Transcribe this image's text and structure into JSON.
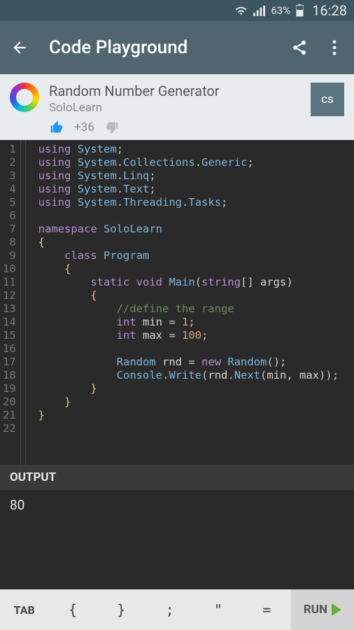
{
  "status": {
    "battery_pct": "63%",
    "time": "16:28"
  },
  "appbar": {
    "title": "Code Playground"
  },
  "project": {
    "name": "Random Number Generator",
    "author": "SoloLearn",
    "votes": "+36",
    "language_badge": "cs"
  },
  "code": {
    "lines": [
      [
        [
          "kw",
          "using"
        ],
        [
          "sp",
          " "
        ],
        [
          "type",
          "System"
        ],
        [
          "punc",
          ";"
        ]
      ],
      [
        [
          "kw",
          "using"
        ],
        [
          "sp",
          " "
        ],
        [
          "type",
          "System"
        ],
        [
          "punc",
          "."
        ],
        [
          "type",
          "Collections"
        ],
        [
          "punc",
          "."
        ],
        [
          "type",
          "Generic"
        ],
        [
          "punc",
          ";"
        ]
      ],
      [
        [
          "kw",
          "using"
        ],
        [
          "sp",
          " "
        ],
        [
          "type",
          "System"
        ],
        [
          "punc",
          "."
        ],
        [
          "type",
          "Linq"
        ],
        [
          "punc",
          ";"
        ]
      ],
      [
        [
          "kw",
          "using"
        ],
        [
          "sp",
          " "
        ],
        [
          "type",
          "System"
        ],
        [
          "punc",
          "."
        ],
        [
          "type",
          "Text"
        ],
        [
          "punc",
          ";"
        ]
      ],
      [
        [
          "kw",
          "using"
        ],
        [
          "sp",
          " "
        ],
        [
          "type",
          "System"
        ],
        [
          "punc",
          "."
        ],
        [
          "type",
          "Threading"
        ],
        [
          "punc",
          "."
        ],
        [
          "type",
          "Tasks"
        ],
        [
          "punc",
          ";"
        ]
      ],
      [],
      [
        [
          "kw",
          "namespace"
        ],
        [
          "sp",
          " "
        ],
        [
          "type",
          "SoloLearn"
        ]
      ],
      [
        [
          "brace",
          "{"
        ]
      ],
      [
        [
          "sp",
          "    "
        ],
        [
          "kw",
          "class"
        ],
        [
          "sp",
          " "
        ],
        [
          "type",
          "Program"
        ]
      ],
      [
        [
          "sp",
          "    "
        ],
        [
          "brace",
          "{"
        ]
      ],
      [
        [
          "sp",
          "        "
        ],
        [
          "kw",
          "static"
        ],
        [
          "sp",
          " "
        ],
        [
          "kw",
          "void"
        ],
        [
          "sp",
          " "
        ],
        [
          "method",
          "Main"
        ],
        [
          "punc",
          "("
        ],
        [
          "kw",
          "string"
        ],
        [
          "punc",
          "[] "
        ],
        [
          "id",
          "args"
        ],
        [
          "punc",
          ")"
        ]
      ],
      [
        [
          "sp",
          "        "
        ],
        [
          "brace",
          "{"
        ]
      ],
      [
        [
          "sp",
          "            "
        ],
        [
          "comment",
          "//define the range"
        ]
      ],
      [
        [
          "sp",
          "            "
        ],
        [
          "kw",
          "int"
        ],
        [
          "sp",
          " "
        ],
        [
          "id",
          "min"
        ],
        [
          "sp",
          " "
        ],
        [
          "punc",
          "="
        ],
        [
          "sp",
          " "
        ],
        [
          "num",
          "1"
        ],
        [
          "punc",
          ";"
        ]
      ],
      [
        [
          "sp",
          "            "
        ],
        [
          "kw",
          "int"
        ],
        [
          "sp",
          " "
        ],
        [
          "id",
          "max"
        ],
        [
          "sp",
          " "
        ],
        [
          "punc",
          "="
        ],
        [
          "sp",
          " "
        ],
        [
          "num",
          "100"
        ],
        [
          "punc",
          ";"
        ]
      ],
      [],
      [
        [
          "sp",
          "            "
        ],
        [
          "type",
          "Random"
        ],
        [
          "sp",
          " "
        ],
        [
          "id",
          "rnd"
        ],
        [
          "sp",
          " "
        ],
        [
          "punc",
          "="
        ],
        [
          "sp",
          " "
        ],
        [
          "kw",
          "new"
        ],
        [
          "sp",
          " "
        ],
        [
          "type",
          "Random"
        ],
        [
          "punc",
          "();"
        ]
      ],
      [
        [
          "sp",
          "            "
        ],
        [
          "type",
          "Console"
        ],
        [
          "punc",
          "."
        ],
        [
          "method",
          "Write"
        ],
        [
          "punc",
          "("
        ],
        [
          "id",
          "rnd"
        ],
        [
          "punc",
          "."
        ],
        [
          "method",
          "Next"
        ],
        [
          "punc",
          "("
        ],
        [
          "id",
          "min"
        ],
        [
          "punc",
          ", "
        ],
        [
          "id",
          "max"
        ],
        [
          "punc",
          "));"
        ]
      ],
      [
        [
          "sp",
          "        "
        ],
        [
          "brace",
          "}"
        ]
      ],
      [
        [
          "sp",
          "    "
        ],
        [
          "brace",
          "}"
        ]
      ],
      [
        [
          "brace",
          "}"
        ]
      ],
      []
    ]
  },
  "output": {
    "header": "OUTPUT",
    "value": "80"
  },
  "keys": {
    "tab": "TAB",
    "lbrace": "{",
    "rbrace": "}",
    "semi": ";",
    "quote": "\"",
    "equals": "=",
    "run": "RUN"
  }
}
